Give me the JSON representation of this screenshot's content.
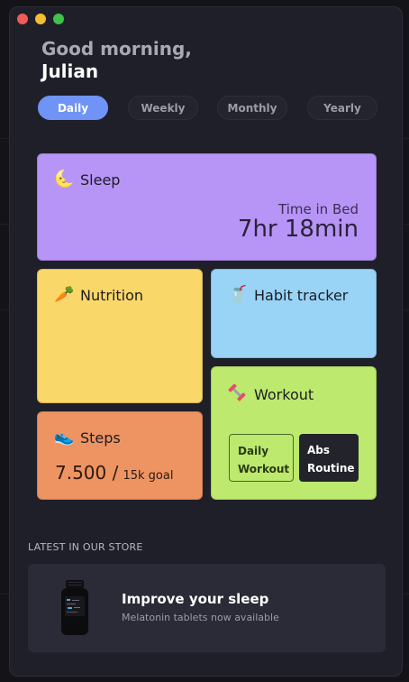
{
  "greeting": {
    "line1": "Good morning,",
    "line2": "Julian"
  },
  "tabs": [
    {
      "label": "Daily",
      "active": true
    },
    {
      "label": "Weekly",
      "active": false
    },
    {
      "label": "Monthly",
      "active": false
    },
    {
      "label": "Yearly",
      "active": false
    }
  ],
  "cards": {
    "sleep": {
      "title": "Sleep",
      "icon": "moon-icon",
      "stat_label": "Time in Bed",
      "stat_value": "7hr 18min"
    },
    "nutrition": {
      "title": "Nutrition",
      "icon": "carrot-icon"
    },
    "habit": {
      "title": "Habit tracker",
      "icon": "drink-cup-icon"
    },
    "steps": {
      "title": "Steps",
      "icon": "sneaker-icon",
      "value": "7.500 /",
      "goal": "15k goal"
    },
    "workout": {
      "title": "Workout",
      "icon": "dumbbell-icon",
      "buttons": [
        {
          "label": "Daily Workout"
        },
        {
          "label": "Abs Routine"
        }
      ]
    }
  },
  "store": {
    "section_label": "LATEST IN OUR STORE",
    "title": "Improve your sleep",
    "subtitle": "Melatonin tablets now available",
    "image": "supplement-bottle-image"
  },
  "colors": {
    "window_bg": "#1f1f29",
    "tab_active": "#6f93f6",
    "sleep": "#b695f7",
    "nutrition": "#fad769",
    "habit": "#99d4f7",
    "steps": "#ee9463",
    "workout": "#bce96e"
  }
}
